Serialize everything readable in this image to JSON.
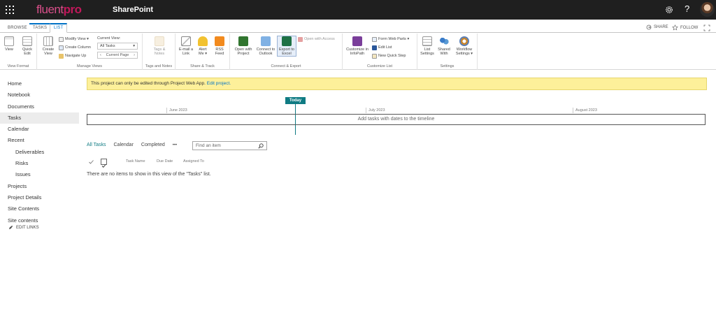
{
  "suite": {
    "brand_prefix": "fluent",
    "brand_suffix": "pro",
    "app_title": "SharePoint",
    "help": "?"
  },
  "ribbon_tabs": [
    "BROWSE",
    "TASKS",
    "LIST"
  ],
  "top_right": {
    "share": "SHARE",
    "follow": "FOLLOW"
  },
  "ribbon": {
    "view_format": {
      "label": "View Format",
      "view": "View",
      "quick_edit_1": "Quick",
      "quick_edit_2": "Edit"
    },
    "manage_views": {
      "label": "Manage Views",
      "create_view_1": "Create",
      "create_view_2": "View",
      "modify_view": "Modify View ▾",
      "create_column": "Create Column",
      "navigate_up": "Navigate Up",
      "current_view_label": "Current View:",
      "current_view_value": "All Tasks",
      "current_page": "Current Page"
    },
    "tags_notes": {
      "label": "Tags and Notes",
      "btn_1": "Tags &",
      "btn_2": "Notes"
    },
    "share_track": {
      "label": "Share & Track",
      "email_1": "E-mail a",
      "email_2": "Link",
      "alert_1": "Alert",
      "alert_2": "Me ▾",
      "rss_1": "RSS",
      "rss_2": "Feed"
    },
    "connect_export": {
      "label": "Connect & Export",
      "project_1": "Open with",
      "project_2": "Project",
      "outlook_1": "Connect to",
      "outlook_2": "Outlook",
      "excel_1": "Export to",
      "excel_2": "Excel",
      "access": "Open with Access"
    },
    "customize_list": {
      "label": "Customize List",
      "infopath_1": "Customize in",
      "infopath_2": "InfoPath",
      "form_parts": "Form Web Parts ▾",
      "edit_list": "Edit List",
      "new_quick_step": "New Quick Step"
    },
    "settings": {
      "label": "Settings",
      "list_1": "List",
      "list_2": "Settings",
      "shared_1": "Shared",
      "shared_2": "With",
      "workflow_1": "Workflow",
      "workflow_2": "Settings ▾"
    }
  },
  "nav": [
    {
      "label": "Home",
      "sub": false
    },
    {
      "label": "Notebook",
      "sub": false
    },
    {
      "label": "Documents",
      "sub": false
    },
    {
      "label": "Tasks",
      "sub": false
    },
    {
      "label": "Calendar",
      "sub": false
    },
    {
      "label": "Recent",
      "sub": false
    },
    {
      "label": "Deliverables",
      "sub": true
    },
    {
      "label": "Risks",
      "sub": true
    },
    {
      "label": "Issues",
      "sub": true
    },
    {
      "label": "Projects",
      "sub": false
    },
    {
      "label": "Project Details",
      "sub": false
    },
    {
      "label": "Site Contents",
      "sub": false
    },
    {
      "label": "Site contents",
      "sub": false
    }
  ],
  "edit_links": "EDIT LINKS",
  "message": {
    "text": "This project can only be edited through Project Web App.",
    "link": "Edit project."
  },
  "timeline": {
    "today": "Today",
    "months": [
      "June 2023",
      "July 2023",
      "August 2023"
    ],
    "placeholder": "Add tasks with dates to the timeline"
  },
  "views": {
    "all": "All Tasks",
    "calendar": "Calendar",
    "completed": "Completed",
    "more": "•••"
  },
  "search": {
    "placeholder": "Find an item"
  },
  "columns": [
    "Task Name",
    "Due Date",
    "Assigned To"
  ],
  "empty_text": "There are no items to show in this view of the \"Tasks\" list.",
  "colors": {
    "accent": "#0072c6",
    "today": "#0f7b83",
    "message_bg": "#fdf09a",
    "brand": "#c0185a"
  }
}
